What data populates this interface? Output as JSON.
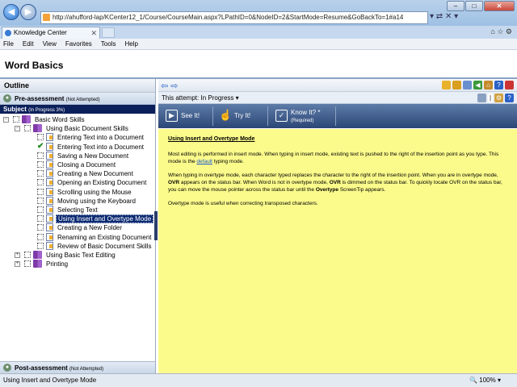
{
  "browser": {
    "address": "http://ahufford-lap/KCenter12_1/Course/CourseMain.aspx?LPathID=0&NodeID=2&StartMode=Resume&GoBackTo=1#a14",
    "tab_title": "Knowledge Center",
    "menu": [
      "File",
      "Edit",
      "View",
      "Favorites",
      "Tools",
      "Help"
    ],
    "window_controls": {
      "minimize": "–",
      "maximize": "□",
      "close": "✕"
    }
  },
  "app": {
    "title": "Word Basics"
  },
  "outline": {
    "header": "Outline",
    "pre_assessment": {
      "name": "Pre-assessment",
      "status": "(Not Attempted)"
    },
    "subject": {
      "name": "Subject",
      "status": "(In Progress 3%)"
    },
    "tree": [
      {
        "label": "Basic Word Skills",
        "kind": "book",
        "level": 0,
        "expander": "-"
      },
      {
        "label": "Using Basic Document Skills",
        "kind": "book",
        "level": 1,
        "expander": "-"
      },
      {
        "label": "Entering Text into a Document",
        "kind": "page",
        "level": 2,
        "state": "empty"
      },
      {
        "label": "Entering Text into a Document",
        "kind": "page",
        "level": 2,
        "state": "done"
      },
      {
        "label": "Saving a New Document",
        "kind": "page",
        "level": 2,
        "state": "empty"
      },
      {
        "label": "Closing a Document",
        "kind": "page",
        "level": 2,
        "state": "empty"
      },
      {
        "label": "Creating a New Document",
        "kind": "page",
        "level": 2,
        "state": "empty"
      },
      {
        "label": "Opening an Existing Document",
        "kind": "page",
        "level": 2,
        "state": "empty"
      },
      {
        "label": "Scrolling using the Mouse",
        "kind": "page",
        "level": 2,
        "state": "empty"
      },
      {
        "label": "Moving using the Keyboard",
        "kind": "page",
        "level": 2,
        "state": "empty"
      },
      {
        "label": "Selecting Text",
        "kind": "page",
        "level": 2,
        "state": "empty"
      },
      {
        "label": "Using Insert and Overtype Mode",
        "kind": "page",
        "level": 2,
        "state": "empty",
        "selected": true
      },
      {
        "label": "Creating a New Folder",
        "kind": "page",
        "level": 2,
        "state": "empty"
      },
      {
        "label": "Renaming an Existing Document",
        "kind": "page",
        "level": 2,
        "state": "empty"
      },
      {
        "label": "Review of Basic Document Skills",
        "kind": "page",
        "level": 2,
        "state": "empty"
      },
      {
        "label": "Using Basic Text Editing",
        "kind": "book",
        "level": 1,
        "expander": "+"
      },
      {
        "label": "Printing",
        "kind": "book",
        "level": 1,
        "expander": "+"
      }
    ],
    "post_assessment": {
      "name": "Post-assessment",
      "status": "(Not Attempted)"
    }
  },
  "right": {
    "attempt_label": "This attempt:",
    "attempt_value": "In Progress",
    "modes": {
      "see": "See It!",
      "try": "Try It!",
      "know": "Know It?",
      "know_sub": "(Required)",
      "know_star": "*"
    },
    "content": {
      "title": "Using Insert and Overtype Mode",
      "p1_a": "Most editing is performed in insert mode. When typing in insert mode, existing text is pushed to the right of the insertion point as you type. This mode is the ",
      "p1_link": "default",
      "p1_b": " typing mode.",
      "p2_a": "When typing in overtype mode, each character typed replaces the character to the right of the insertion point. When you are in overtype mode, ",
      "p2_b1": "OVR",
      "p2_c": " appears on the status bar. When Word is not in overtype mode, ",
      "p2_b2": "OVR",
      "p2_d": " is dimmed on the status bar. To quickly locate OVR on the status bar, you can move the mouse pointer across the status bar until the ",
      "p2_b3": "Overtype",
      "p2_e": " ScreenTip appears.",
      "p3": "Overtype mode is useful when correcting transposed characters."
    }
  },
  "status": {
    "text": "Using Insert and Overtype Mode",
    "zoom": "100%"
  }
}
